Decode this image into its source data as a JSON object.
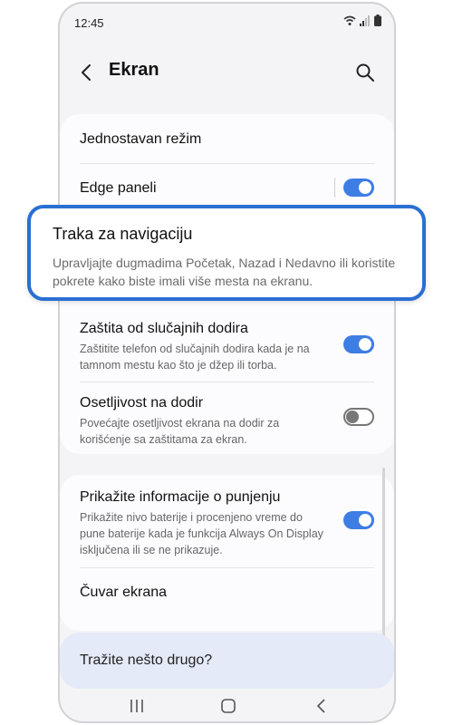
{
  "status_bar": {
    "time": "12:45"
  },
  "header": {
    "title": "Ekran"
  },
  "settings": {
    "simple_mode": {
      "title": "Jednostavan režim"
    },
    "edge_panels": {
      "title": "Edge paneli",
      "enabled": true
    },
    "navigation_bar": {
      "title": "Traka za navigaciju",
      "description": "Upravljajte dugmadima Početak, Nazad i Nedavno ili koristite pokrete kako biste imali više mesta na ekranu."
    },
    "accidental_touch": {
      "title": "Zaštita od slučajnih dodira",
      "description": "Zaštitite telefon od slučajnih dodira kada je na tamnom mestu kao što je džep ili torba.",
      "enabled": true
    },
    "touch_sensitivity": {
      "title": "Osetljivost na dodir",
      "description": "Povećajte osetljivost ekrana na dodir za korišćenje sa zaštitama za ekran.",
      "enabled": false
    },
    "charging_info": {
      "title": "Prikažite informacije o punjenju",
      "description": "Prikažite nivo baterije i procenjeno vreme do pune baterije kada je funkcija Always On Display isključena ili se ne prikazuje.",
      "enabled": true
    },
    "screen_saver": {
      "title": "Čuvar ekrana"
    }
  },
  "help": {
    "text": "Tražite nešto drugo?"
  },
  "colors": {
    "accent": "#3e7de4",
    "highlight_border": "#2a6fd3"
  },
  "icons": [
    "back-icon",
    "search-icon",
    "wifi-icon",
    "signal-icon",
    "battery-icon",
    "recents-icon",
    "home-icon",
    "back-nav-icon"
  ]
}
